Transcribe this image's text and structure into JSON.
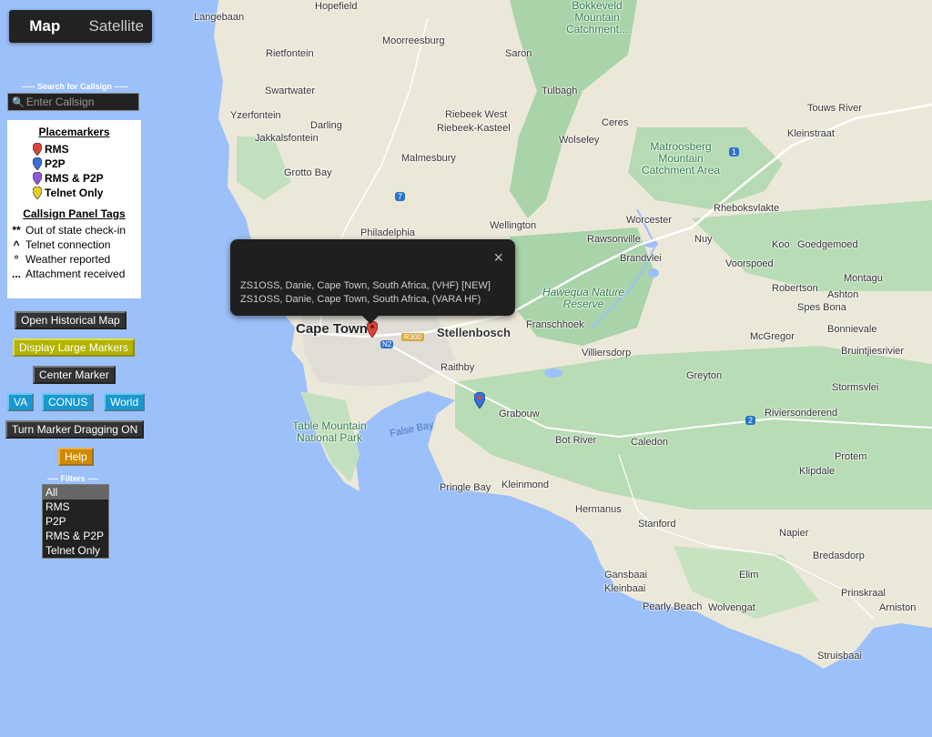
{
  "map_type": {
    "map": "Map",
    "satellite": "Satellite"
  },
  "search": {
    "heading": "----- Search for Callsign -----",
    "placeholder": "Enter Callsign"
  },
  "placemarkers": {
    "title": "Placemarkers",
    "items": [
      {
        "label": "RMS",
        "color": "#d9453b"
      },
      {
        "label": "P2P",
        "color": "#3b6fd9"
      },
      {
        "label": "RMS & P2P",
        "color": "#8f5ad9"
      },
      {
        "label": "Telnet Only",
        "color": "#e6cf2a"
      }
    ]
  },
  "callsign_tags": {
    "title": "Callsign Panel Tags",
    "items": [
      {
        "symbol": "**",
        "label": "Out of state check-in"
      },
      {
        "symbol": "^",
        "label": "Telnet connection"
      },
      {
        "symbol": "°",
        "label": "Weather reported"
      },
      {
        "symbol": "...",
        "label": "Attachment received"
      }
    ]
  },
  "buttons": {
    "historical": "Open Historical Map",
    "large_markers": "Display Large Markers",
    "center_marker": "Center Marker",
    "va": "VA",
    "conus": "CONUS",
    "world": "World",
    "dragging": "Turn Marker Dragging ON",
    "help": "Help"
  },
  "filters": {
    "heading": "---- Filters ----",
    "options": [
      "All",
      "RMS",
      "P2P",
      "RMS & P2P",
      "Telnet Only"
    ],
    "selected": "All"
  },
  "popup": {
    "lines": [
      "ZS1OSS, Danie, Cape Town, South Africa, (VHF) [NEW]",
      "ZS1OSS, Danie, Cape Town, South Africa, (VARA HF)"
    ],
    "close_icon": "×"
  },
  "places": {
    "hopefield": "Hopefield",
    "langebaan": "Langebaan",
    "moorreesburg": "Moorreesburg",
    "saron": "Saron",
    "rietfontein": "Rietfontein",
    "swartwater": "Swartwater",
    "tulbagh": "Tulbagh",
    "yzerfontein": "Yzerfontein",
    "riebeek_west": "Riebeek West",
    "riebeek_kasteel": "Riebeek-Kasteel",
    "ceres": "Ceres",
    "darling": "Darling",
    "jakkalsfontein": "Jakkalsfontein",
    "wolseley": "Wolseley",
    "touws_river": "Touws River",
    "kleinstraat": "Kleinstraat",
    "malmesbury": "Malmesbury",
    "grotto_bay": "Grotto Bay",
    "wellington": "Wellington",
    "worcester": "Worcester",
    "rheboksvlakte": "Rheboksvlakte",
    "philadelphia": "Philadelphia",
    "rawsonville": "Rawsonville",
    "nuy": "Nuy",
    "koo": "Koo",
    "goedgemoed": "Goedgemoed",
    "brandvlei": "Brandvlei",
    "voorspoed": "Voorspoed",
    "montagu": "Montagu",
    "robertson": "Robertson",
    "ashton": "Ashton",
    "spes_bona": "Spes Bona",
    "cape_town": "Cape Town",
    "stellenbosch": "Stellenbosch",
    "franschhoek": "Franschhoek",
    "mcgregor": "McGregor",
    "bonnievale": "Bonnievale",
    "bruintjiesrivier": "Bruintjiesrivier",
    "villiersdorp": "Villiersdorp",
    "raithby": "Raithby",
    "greyton": "Greyton",
    "stormsvlei": "Stormsvlei",
    "grabouw": "Grabouw",
    "riviersonderend": "Riviersonderend",
    "bot_river": "Bot River",
    "caledon": "Caledon",
    "protem": "Protem",
    "klipdale": "Klipdale",
    "pringle_bay": "Pringle Bay",
    "kleinmond": "Kleinmond",
    "hermanus": "Hermanus",
    "stanford": "Stanford",
    "napier": "Napier",
    "bredasdorp": "Bredasdorp",
    "gansbaai": "Gansbaai",
    "kleinbaai": "Kleinbaai",
    "elim": "Elim",
    "prinskraal": "Prinskraal",
    "pearly_beach": "Pearly Beach",
    "wolvengat": "Wolvengat",
    "arniston": "Arniston",
    "struisbaai": "Struisbaai",
    "false_bay": "False Bay",
    "bokkeveld": "Bokkeveld Mountain Catchment...",
    "matroosberg": "Matroosberg Mountain Catchment Area",
    "hawequa": "Hawequa Nature Reserve",
    "table_mountain": "Table Mountain National Park",
    "route_r300": "R300",
    "route_1": "1",
    "route_2": "2",
    "route_7": "7",
    "route_n2": "N2"
  }
}
